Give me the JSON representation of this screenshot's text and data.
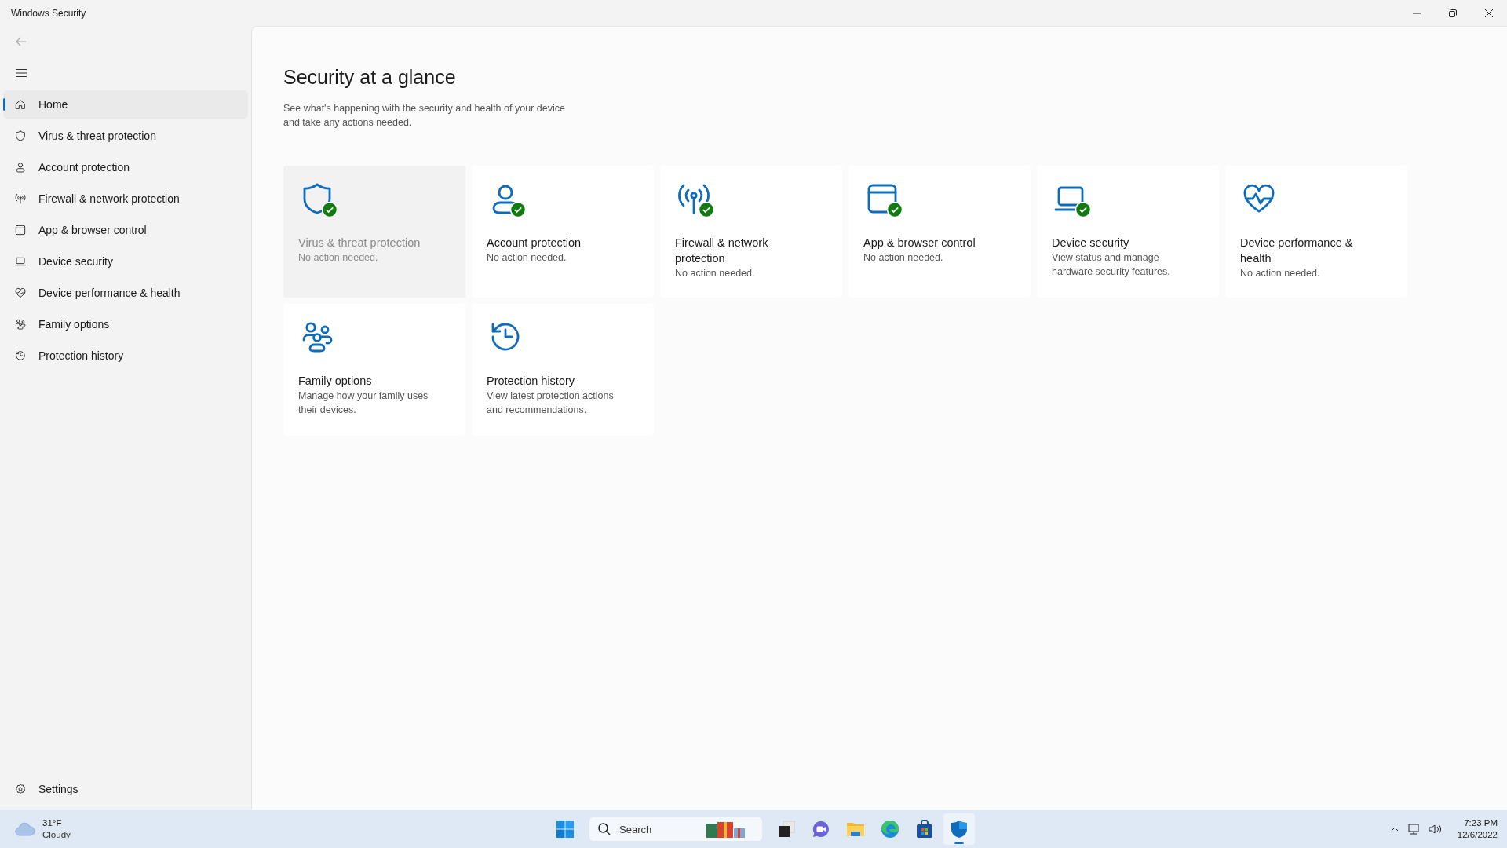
{
  "window": {
    "title": "Windows Security"
  },
  "sidebar": {
    "items": [
      {
        "label": "Home",
        "kind": "home",
        "selected": true
      },
      {
        "label": "Virus & threat protection",
        "kind": "shield",
        "selected": false
      },
      {
        "label": "Account protection",
        "kind": "person",
        "selected": false
      },
      {
        "label": "Firewall & network protection",
        "kind": "antenna",
        "selected": false
      },
      {
        "label": "App & browser control",
        "kind": "browser",
        "selected": false
      },
      {
        "label": "Device security",
        "kind": "laptop",
        "selected": false
      },
      {
        "label": "Device performance & health",
        "kind": "heart",
        "selected": false
      },
      {
        "label": "Family options",
        "kind": "family",
        "selected": false
      },
      {
        "label": "Protection history",
        "kind": "history",
        "selected": false
      }
    ],
    "settings": {
      "label": "Settings"
    }
  },
  "main": {
    "heading": "Security at a glance",
    "description": "See what's happening with the security and health of your device and take any actions needed.",
    "cards": [
      {
        "title": "Virus & threat protection",
        "status": "No action needed.",
        "kind": "shield",
        "ok": true,
        "hovered": true
      },
      {
        "title": "Account protection",
        "status": "No action needed.",
        "kind": "person",
        "ok": true,
        "hovered": false
      },
      {
        "title": "Firewall & network protection",
        "status": "No action needed.",
        "kind": "antenna",
        "ok": true,
        "hovered": false
      },
      {
        "title": "App & browser control",
        "status": "No action needed.",
        "kind": "browser",
        "ok": true,
        "hovered": false
      },
      {
        "title": "Device security",
        "status": "View status and manage hardware security features.",
        "kind": "laptop",
        "ok": true,
        "hovered": false
      },
      {
        "title": "Device performance & health",
        "status": "No action needed.",
        "kind": "heart",
        "ok": false,
        "hovered": false
      },
      {
        "title": "Family options",
        "status": "Manage how your family uses their devices.",
        "kind": "family",
        "ok": false,
        "hovered": false
      },
      {
        "title": "Protection history",
        "status": "View latest protection actions and recommendations.",
        "kind": "history",
        "ok": false,
        "hovered": false
      }
    ]
  },
  "taskbar": {
    "weather": {
      "temperature": "31°F",
      "condition": "Cloudy"
    },
    "search": {
      "placeholder": "Search"
    },
    "apps": [
      {
        "kind": "taskview",
        "active": false
      },
      {
        "kind": "chat",
        "active": false
      },
      {
        "kind": "folder",
        "active": false
      },
      {
        "kind": "edge",
        "active": false
      },
      {
        "kind": "store",
        "active": false
      },
      {
        "kind": "security",
        "active": true
      }
    ],
    "clock": {
      "time": "7:23 PM",
      "date": "12/6/2022"
    }
  }
}
